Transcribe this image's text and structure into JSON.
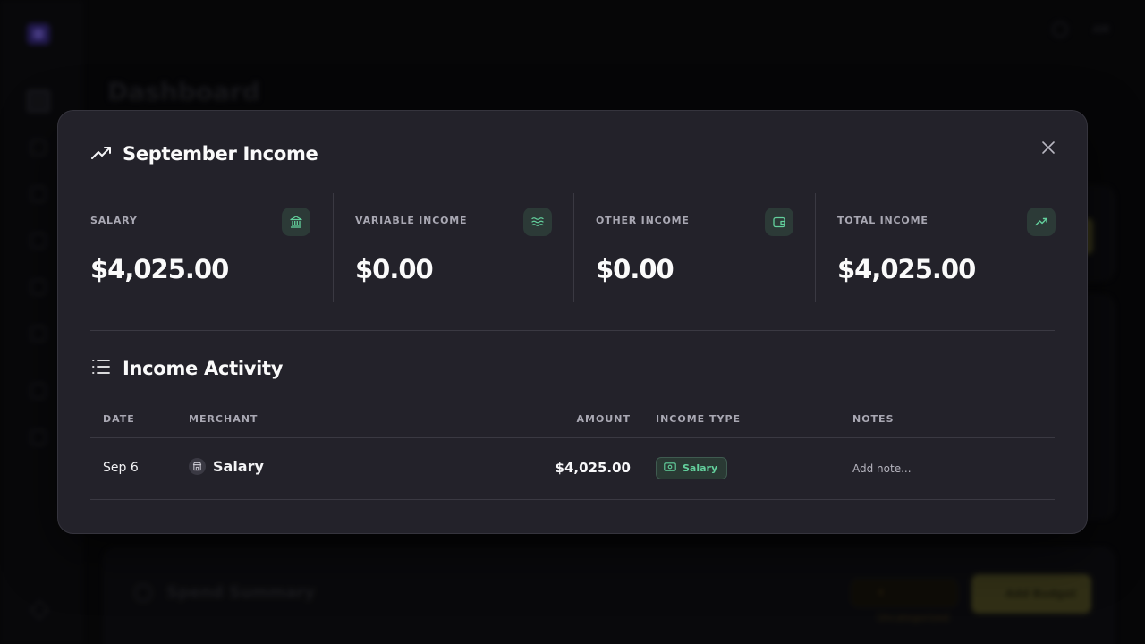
{
  "background": {
    "page_title": "Dashboard",
    "top_user": "AM",
    "spend_summary_title": "Spend Summary",
    "pill_label": "4 Uncategorized",
    "add_budget_label": "Add Budget"
  },
  "modal": {
    "title": "September Income",
    "stats": [
      {
        "label": "SALARY",
        "value": "$4,025.00",
        "icon": "bank-icon"
      },
      {
        "label": "VARIABLE INCOME",
        "value": "$0.00",
        "icon": "waves-icon"
      },
      {
        "label": "OTHER INCOME",
        "value": "$0.00",
        "icon": "wallet-icon"
      },
      {
        "label": "TOTAL INCOME",
        "value": "$4,025.00",
        "icon": "trending-up-icon"
      }
    ],
    "activity": {
      "title": "Income Activity",
      "columns": [
        "DATE",
        "MERCHANT",
        "AMOUNT",
        "INCOME TYPE",
        "NOTES"
      ],
      "rows": [
        {
          "date": "Sep 6",
          "merchant": "Salary",
          "amount": "$4,025.00",
          "income_type": "Salary",
          "notes_placeholder": "Add note..."
        }
      ]
    }
  },
  "colors": {
    "modal_bg": "#23222a",
    "accent_green": "#63d19d",
    "icon_chip_bg": "#2c3a37",
    "text_primary": "#fafafa",
    "text_muted": "#a9a8b3"
  }
}
